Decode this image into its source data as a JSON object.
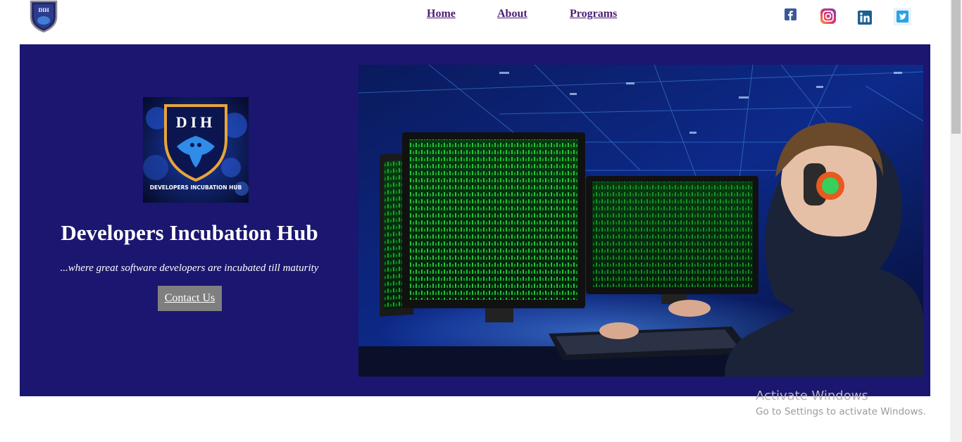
{
  "header": {
    "logo_text": "DIH",
    "nav": [
      {
        "label": "Home"
      },
      {
        "label": "About"
      },
      {
        "label": "Programs"
      }
    ],
    "social": [
      "facebook-icon",
      "instagram-icon",
      "linkedin-icon",
      "twitter-icon"
    ]
  },
  "hero": {
    "logo_letters": "DIH",
    "logo_caption": "DEVELOPERS INCUBATION HUB",
    "title": "Developers Incubation Hub",
    "tagline": "...where great software developers are incubated till maturity",
    "contact_label": "Contact Us"
  },
  "watermark": {
    "title": "Activate Windows",
    "subtitle": "Go to Settings to activate Windows."
  },
  "colors": {
    "hero_bg": "#1b1670",
    "nav_link": "#4b1d74",
    "button_bg": "#7f7f7f"
  }
}
